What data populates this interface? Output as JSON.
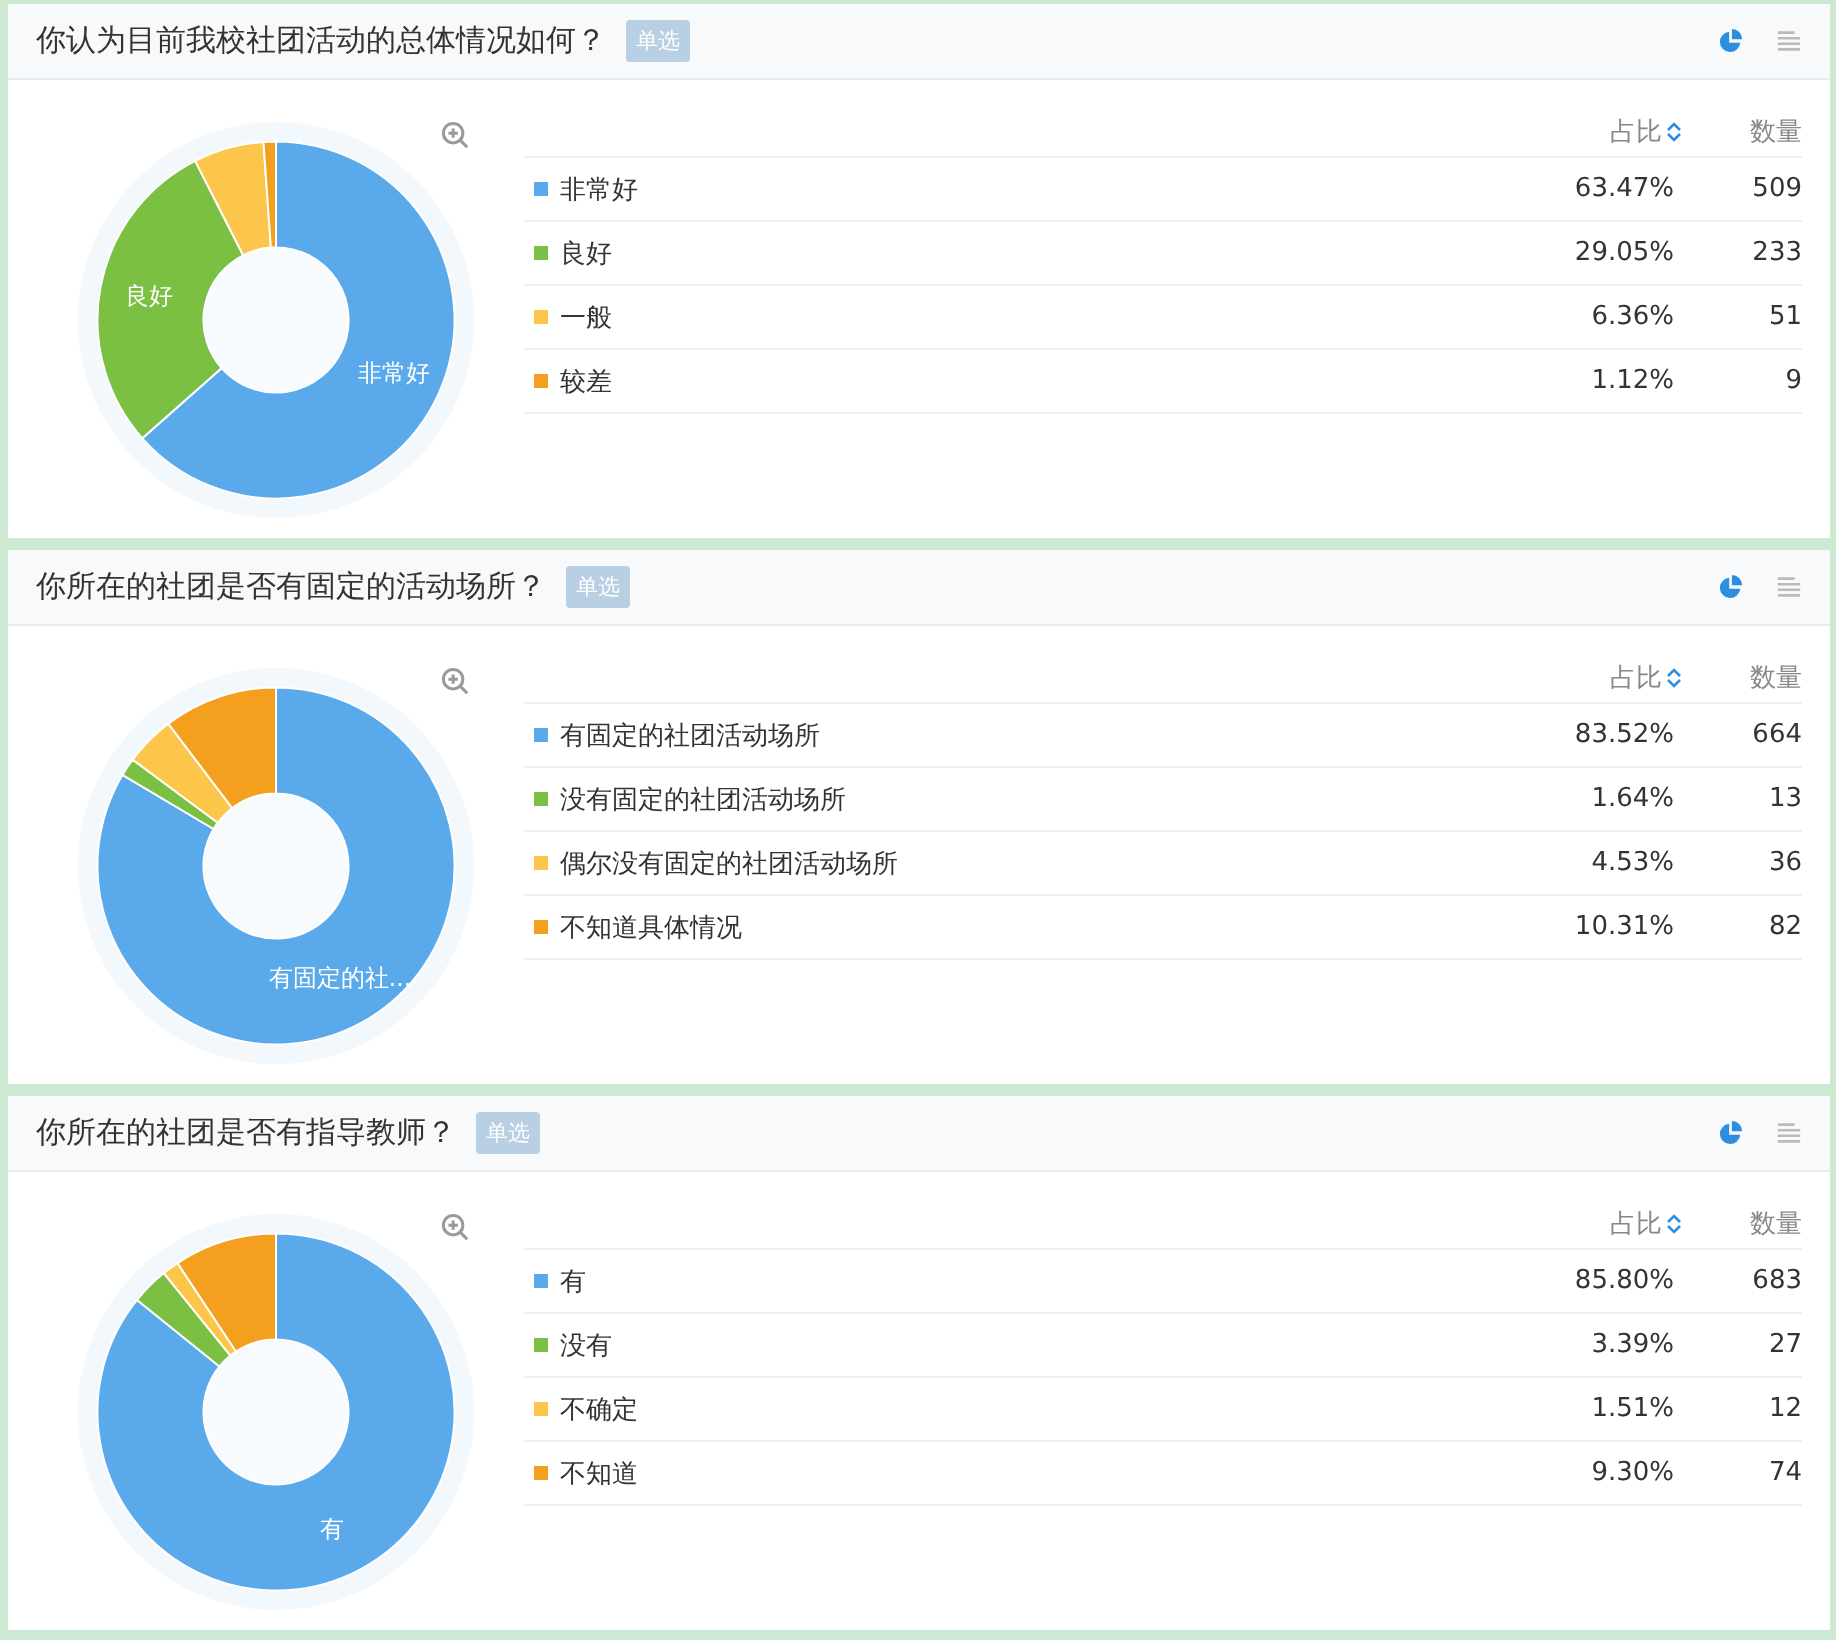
{
  "questions": [
    {
      "title": "你认为目前我校社团活动的总体情况如何？",
      "tag": "单选",
      "columns": {
        "percent": "占比",
        "count": "数量"
      },
      "rows": [
        {
          "color": "#5aa9ea",
          "percent": "63.47%",
          "count": "509"
        },
        {
          "color": "#7bc043",
          "percent": "29.05%",
          "count": "233"
        },
        {
          "color": "#fcc64a",
          "percent": "6.36%",
          "count": "51"
        },
        {
          "color": "#f59f1e",
          "percent": "1.12%",
          "count": "9"
        }
      ],
      "chart_data": {
        "type": "donut",
        "legend": "right",
        "categories": [
          "非常好",
          "良好",
          "一般",
          "较差"
        ],
        "values": [
          63.47,
          29.05,
          6.36,
          1.12
        ],
        "annotations": [
          {
            "x": "非常好",
            "text": "非常好"
          },
          {
            "x": "良好",
            "text": "良好"
          }
        ]
      }
    },
    {
      "title": "你所在的社团是否有固定的活动场所？",
      "tag": "单选",
      "columns": {
        "percent": "占比",
        "count": "数量"
      },
      "rows": [
        {
          "color": "#5aa9ea",
          "percent": "83.52%",
          "count": "664"
        },
        {
          "color": "#7bc043",
          "percent": "1.64%",
          "count": "13"
        },
        {
          "color": "#fcc64a",
          "percent": "4.53%",
          "count": "36"
        },
        {
          "color": "#f59f1e",
          "percent": "10.31%",
          "count": "82"
        }
      ],
      "chart_data": {
        "type": "donut",
        "legend": "right",
        "categories": [
          "有固定的社团活动场所",
          "没有固定的社团活动场所",
          "偶尔没有固定的社团活动场所",
          "不知道具体情况"
        ],
        "values": [
          83.52,
          1.64,
          4.53,
          10.31
        ],
        "annotations": [
          {
            "x": "有固定的社团活动场所",
            "text": "有固定的社..."
          }
        ]
      }
    },
    {
      "title": "你所在的社团是否有指导教师？",
      "tag": "单选",
      "columns": {
        "percent": "占比",
        "count": "数量"
      },
      "rows": [
        {
          "color": "#5aa9ea",
          "percent": "85.80%",
          "count": "683"
        },
        {
          "color": "#7bc043",
          "percent": "3.39%",
          "count": "27"
        },
        {
          "color": "#fcc64a",
          "percent": "1.51%",
          "count": "12"
        },
        {
          "color": "#f59f1e",
          "percent": "9.30%",
          "count": "74"
        }
      ],
      "chart_data": {
        "type": "donut",
        "legend": "right",
        "categories": [
          "有",
          "没有",
          "不确定",
          "不知道"
        ],
        "values": [
          85.8,
          3.39,
          1.51,
          9.3
        ],
        "annotations": [
          {
            "x": "有",
            "text": "有"
          }
        ]
      }
    }
  ]
}
